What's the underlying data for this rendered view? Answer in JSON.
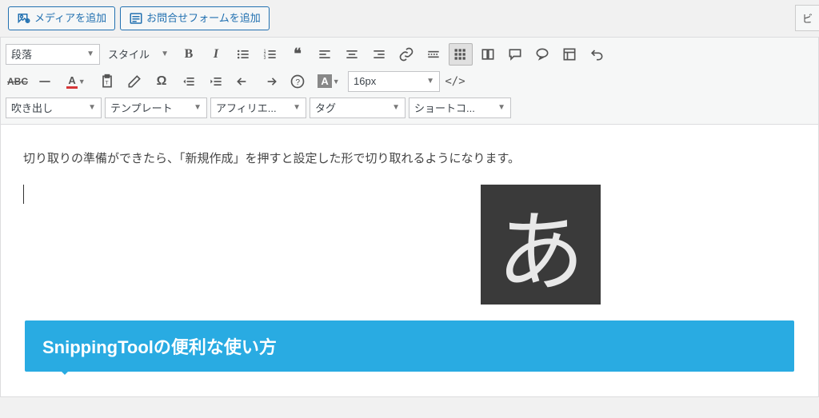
{
  "topbar": {
    "addMedia": "メディアを追加",
    "addContactForm": "お問合せフォームを追加"
  },
  "rightTab": "ビ",
  "toolbar": {
    "format": "段落",
    "style": "スタイル",
    "fontSize": "16px",
    "row3": {
      "balloon": "吹き出し",
      "template": "テンプレート",
      "affiliate": "アフィリエ...",
      "tag": "タグ",
      "shortcode": "ショートコ..."
    }
  },
  "content": {
    "paragraph": "切り取りの準備ができたら、「新規作成」を押すと設定した形で切り取れるようになります。",
    "imeChar": "あ",
    "calloutTitle": "SnippingToolの便利な使い方"
  }
}
